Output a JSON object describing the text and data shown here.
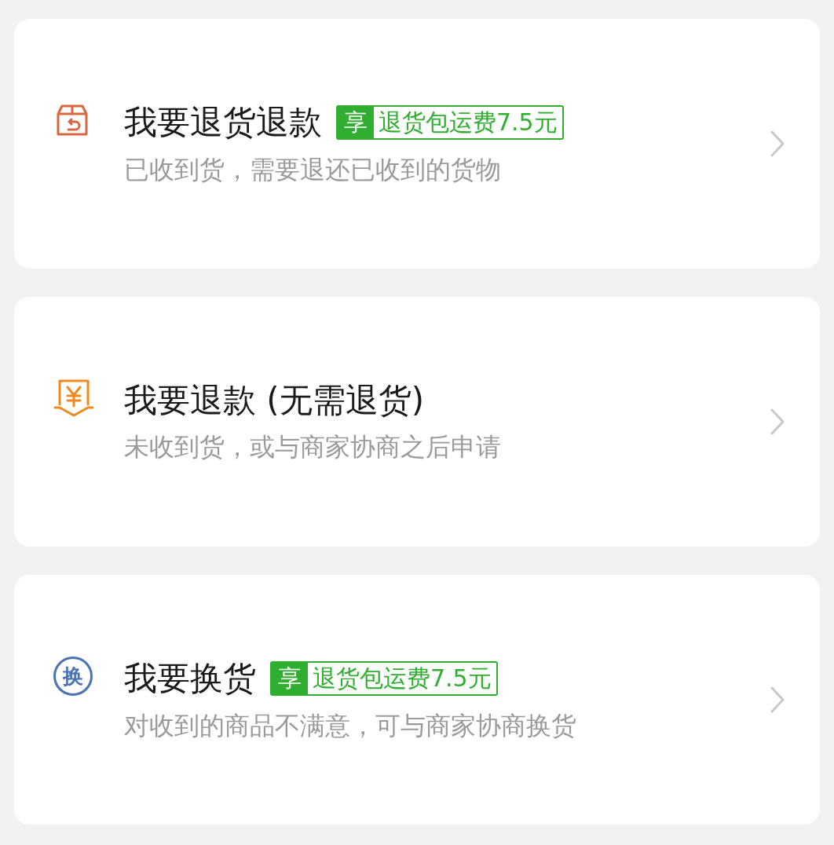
{
  "options": [
    {
      "kind": "return",
      "title": "我要退货退款",
      "badge": {
        "prefix": "享",
        "text": "退货包运费7.5元"
      },
      "description": "已收到货，需要退还已收到的货物"
    },
    {
      "kind": "refund",
      "title": "我要退款 (无需退货)",
      "description": "未收到货，或与商家协商之后申请"
    },
    {
      "kind": "exchange",
      "icon_label": "换",
      "title": "我要换货",
      "badge": {
        "prefix": "享",
        "text": "退货包运费7.5元"
      },
      "description": "对收到的商品不满意，可与商家协商换货"
    }
  ]
}
